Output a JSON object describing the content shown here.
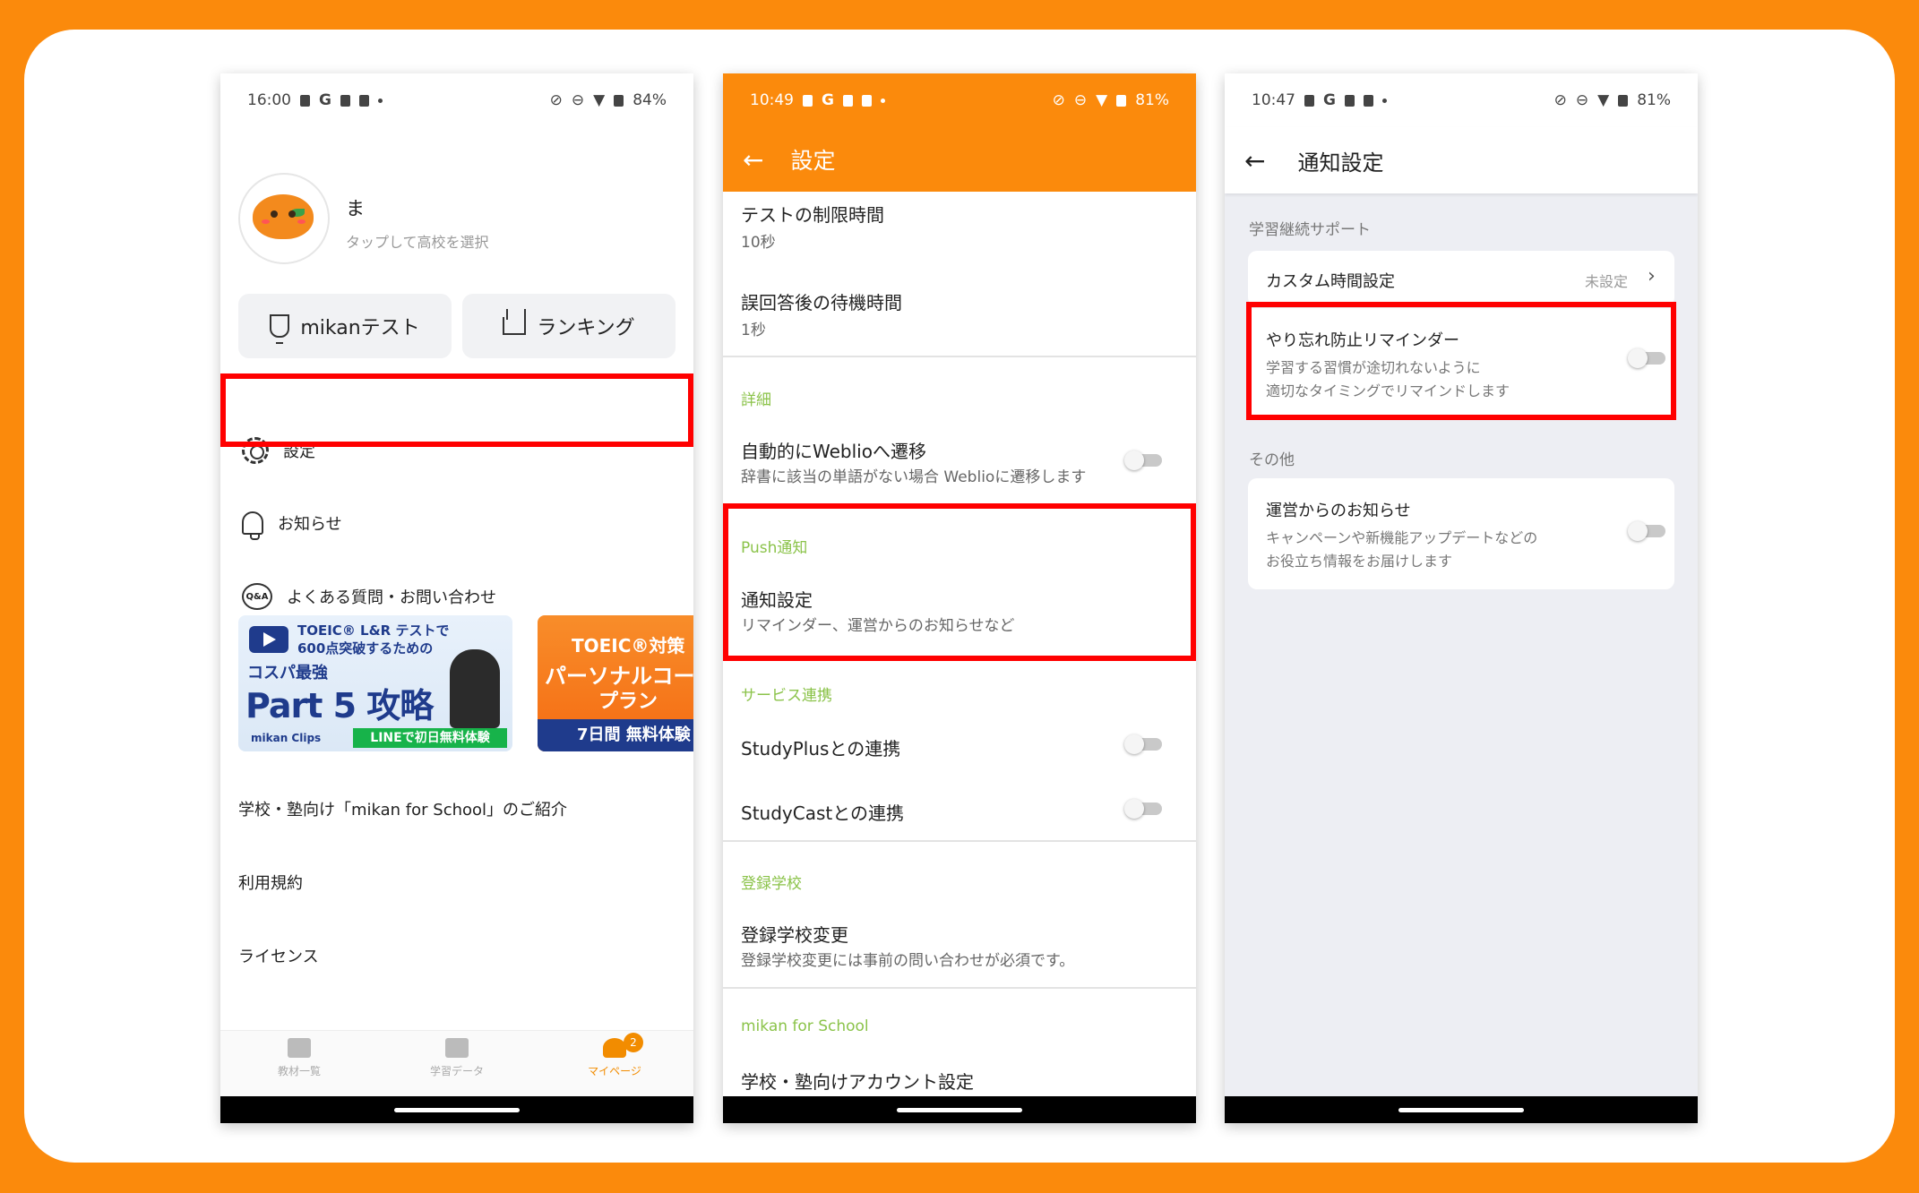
{
  "phone1": {
    "status": {
      "time": "16:00",
      "battery": "84%"
    },
    "user": {
      "name": "ま",
      "school_prompt": "タップして高校を選択"
    },
    "buttons": {
      "test": "mikanテスト",
      "ranking": "ランキング"
    },
    "menu": {
      "settings": "設定",
      "notices": "お知らせ",
      "faq": "よくある質問・お問い合わせ"
    },
    "banner1": {
      "line1": "TOEIC® L&R テストで",
      "line2": "600点突破するための",
      "line3": "コスパ最強",
      "line4": "Part 5 攻略",
      "brand": "mikan Clips",
      "cta": "LINEで初日無料体験"
    },
    "banner2": {
      "line1": "TOEIC®対策",
      "line2": "パーソナルコー",
      "line3": "プラン",
      "cta": "7日間 無料体験"
    },
    "links": [
      "学校・塾向け「mikan for School」のご紹介",
      "利用規約",
      "ライセンス"
    ],
    "tabs": [
      {
        "label": "教材一覧"
      },
      {
        "label": "学習データ"
      },
      {
        "label": "マイページ",
        "badge": "2"
      }
    ]
  },
  "phone2": {
    "status": {
      "time": "10:49",
      "battery": "81%"
    },
    "title": "設定",
    "rows": {
      "test_limit": {
        "title": "テストの制限時間",
        "value": "10秒"
      },
      "wrong_wait": {
        "title": "誤回答後の待機時間",
        "value": "1秒"
      },
      "cat_detail": "詳細",
      "weblio": {
        "title": "自動的にWeblioへ遷移",
        "sub": "辞書に該当の単語がない場合 Weblioに遷移します"
      },
      "cat_push": "Push通知",
      "notify": {
        "title": "通知設定",
        "sub": "リマインダー、運営からのお知らせなど"
      },
      "cat_service": "サービス連携",
      "studyplus": "StudyPlusとの連携",
      "studycast": "StudyCastとの連携",
      "cat_school": "登録学校",
      "school_change": {
        "title": "登録学校変更",
        "sub": "登録学校変更には事前の問い合わせが必須です。"
      },
      "cat_mfs": "mikan for School",
      "school_account": "学校・塾向けアカウント設定"
    }
  },
  "phone3": {
    "status": {
      "time": "10:47",
      "battery": "81%"
    },
    "title": "通知設定",
    "section1": "学習継続サポート",
    "custom": {
      "title": "カスタム時間設定",
      "value": "未設定"
    },
    "reminder": {
      "title": "やり忘れ防止リマインダー",
      "sub1": "学習する習慣が途切れないように",
      "sub2": "適切なタイミングでリマインドします"
    },
    "section2": "その他",
    "news": {
      "title": "運営からのお知らせ",
      "sub1": "キャンペーンや新機能アップデートなどの",
      "sub2": "お役立ち情報をお届けします"
    }
  },
  "colors": {
    "background": "#fb8a0c",
    "accent": "#fb8a0c",
    "highlight": "#ff0000",
    "category": "#8bc34a"
  }
}
